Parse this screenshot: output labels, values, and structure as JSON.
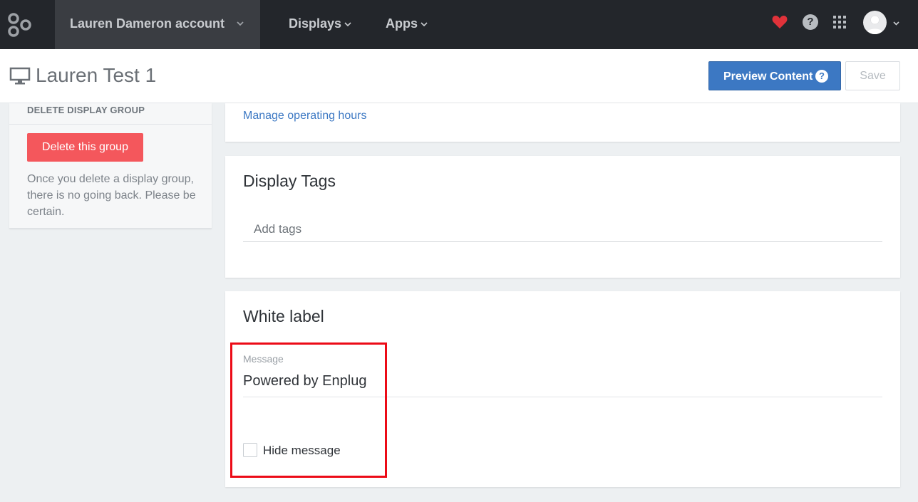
{
  "topbar": {
    "account_name": "Lauren Dameron account",
    "nav": [
      {
        "label": "Displays"
      },
      {
        "label": "Apps"
      }
    ],
    "icons": {
      "logo": "enplug-logo-icon",
      "favorite": "heart-icon",
      "help": "help-icon",
      "apps_grid": "grid-icon",
      "avatar": "user-avatar-icon"
    },
    "help_glyph": "?",
    "heart_color": "#e0323a"
  },
  "header": {
    "title": "Lauren Test 1",
    "preview_label": "Preview Content",
    "preview_help_glyph": "?",
    "save_label": "Save",
    "accent_color": "#3c78c3"
  },
  "left_panel": {
    "section_title": "DELETE DISPLAY GROUP",
    "delete_button": "Delete this group",
    "warning": "Once you delete a display group, there is no going back. Please be certain.",
    "danger_color": "#f4575c"
  },
  "operating_hours": {
    "link": "Manage operating hours"
  },
  "display_tags": {
    "title": "Display Tags",
    "placeholder": "Add tags"
  },
  "white_label": {
    "title": "White label",
    "message_label": "Message",
    "message_value": "Powered by Enplug",
    "hide_label": "Hide message",
    "hide_checked": false
  },
  "annotation": {
    "highlight_color": "#ec0b17"
  }
}
